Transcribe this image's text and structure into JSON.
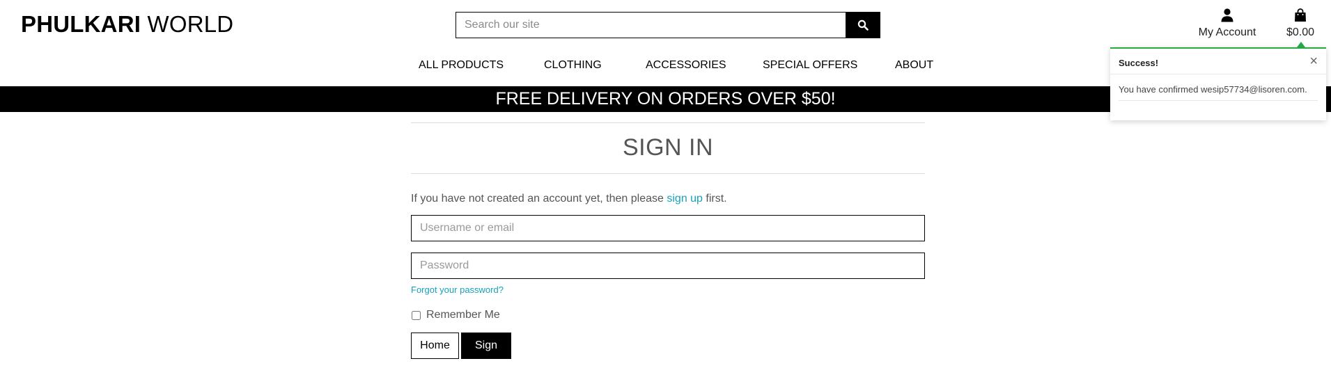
{
  "header": {
    "logo_bold": "PHULKARI",
    "logo_light": "WORLD",
    "search": {
      "placeholder": "Search our site",
      "value": ""
    },
    "account_label": "My Account",
    "bag_total": "$0.00"
  },
  "nav": {
    "items": [
      {
        "label": "ALL PRODUCTS"
      },
      {
        "label": "CLOTHING"
      },
      {
        "label": "ACCESSORIES"
      },
      {
        "label": "SPECIAL OFFERS"
      },
      {
        "label": "ABOUT"
      }
    ]
  },
  "banner": {
    "text": "FREE DELIVERY ON ORDERS OVER $50!"
  },
  "signin": {
    "title": "SIGN IN",
    "intro_before": "If you have not created an account yet, then please ",
    "intro_link": "sign up",
    "intro_after": " first.",
    "username_placeholder": "Username or email",
    "password_placeholder": "Password",
    "forgot_link": "Forgot your password?",
    "remember_label": "Remember Me",
    "home_button": "Home",
    "signin_button": "Sign In"
  },
  "toast": {
    "title": "Success!",
    "close_glyph": "×",
    "message": "You have confirmed wesip57734@lisoren.com."
  },
  "colors": {
    "accent_link": "#17a2b8",
    "toast_border": "#28a745",
    "banner_bg": "#000000"
  }
}
